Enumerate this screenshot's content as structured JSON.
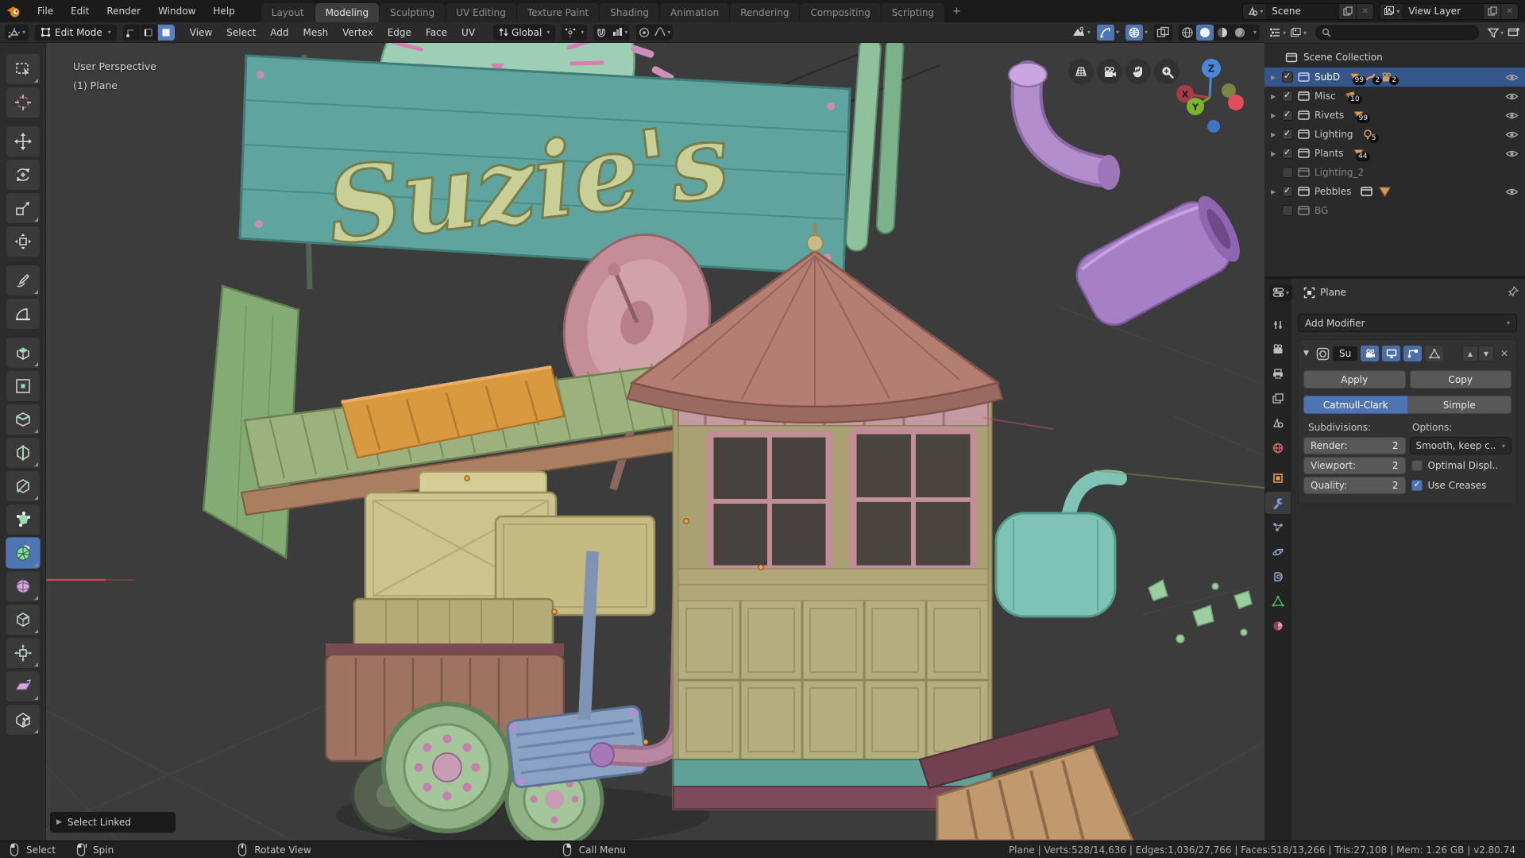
{
  "colors": {
    "accent_blue": "#4772b3",
    "selection_blue": "#35568b",
    "active_tool_blue": "#4f76b3",
    "badge_orange": "#d89a63",
    "viewport_bg": "#3c3c3c"
  },
  "topbar": {
    "menus": [
      {
        "label": "File"
      },
      {
        "label": "Edit"
      },
      {
        "label": "Render"
      },
      {
        "label": "Window"
      },
      {
        "label": "Help"
      }
    ],
    "workspaces": [
      {
        "label": "Layout"
      },
      {
        "label": "Modeling",
        "active": true
      },
      {
        "label": "Sculpting"
      },
      {
        "label": "UV Editing"
      },
      {
        "label": "Texture Paint"
      },
      {
        "label": "Shading"
      },
      {
        "label": "Animation"
      },
      {
        "label": "Rendering"
      },
      {
        "label": "Compositing"
      },
      {
        "label": "Scripting"
      }
    ],
    "add_workspace": "+",
    "scene": {
      "label": "Scene",
      "clear": "✕"
    },
    "view_layer": {
      "label": "View Layer",
      "clear": "✕"
    }
  },
  "viewport_header": {
    "mode": "Edit Mode",
    "menus": [
      {
        "label": "View"
      },
      {
        "label": "Select"
      },
      {
        "label": "Add"
      },
      {
        "label": "Mesh"
      },
      {
        "label": "Vertex"
      },
      {
        "label": "Edge"
      },
      {
        "label": "Face"
      },
      {
        "label": "UV"
      }
    ],
    "orientation": "Global"
  },
  "toolbar": {
    "active_tool": "spin",
    "tools": [
      {
        "id": "select-box",
        "sub": true
      },
      {
        "id": "cursor"
      },
      {
        "id": "move",
        "gap": true
      },
      {
        "id": "rotate"
      },
      {
        "id": "scale",
        "sub": true
      },
      {
        "id": "transform"
      },
      {
        "id": "annotate",
        "gap": true,
        "sub": true
      },
      {
        "id": "measure"
      },
      {
        "id": "extrude-region",
        "gap": true,
        "sub": true
      },
      {
        "id": "inset-faces"
      },
      {
        "id": "bevel",
        "sub": true
      },
      {
        "id": "loop-cut",
        "sub": true
      },
      {
        "id": "knife",
        "sub": true
      },
      {
        "id": "poly-build"
      },
      {
        "id": "spin",
        "sub": true
      },
      {
        "id": "smooth",
        "sub": true
      },
      {
        "id": "edge-slide",
        "sub": true
      },
      {
        "id": "shrink-fatten",
        "sub": true
      },
      {
        "id": "shear",
        "sub": true
      },
      {
        "id": "rip-region",
        "sub": true
      }
    ]
  },
  "viewport": {
    "overlay_line1": "User Perspective",
    "overlay_line2": "(1) Plane",
    "sign_text": "Suzie's",
    "operator_panel": "Select Linked",
    "gizmo": {
      "x": "X",
      "y": "Y",
      "z": "Z"
    }
  },
  "outliner": {
    "root": "Scene Collection",
    "rows": [
      {
        "name": "SubD",
        "checked": true,
        "selected": true,
        "arrow": true,
        "eye": true,
        "badges": [
          {
            "icon": "mesh",
            "count": "99"
          },
          {
            "icon": "curve",
            "count": "2"
          },
          {
            "icon": "camera",
            "count": "2"
          }
        ]
      },
      {
        "name": "Misc",
        "checked": true,
        "arrow": true,
        "eye": true,
        "badges": [
          {
            "icon": "mesh-multi",
            "count": "10"
          }
        ]
      },
      {
        "name": "Rivets",
        "checked": true,
        "arrow": true,
        "eye": true,
        "badges": [
          {
            "icon": "mesh",
            "count": "99"
          }
        ]
      },
      {
        "name": "Lighting",
        "checked": true,
        "arrow": true,
        "eye": true,
        "badges": [
          {
            "icon": "light",
            "count": "5"
          }
        ]
      },
      {
        "name": "Plants",
        "checked": true,
        "arrow": true,
        "eye": true,
        "badges": [
          {
            "icon": "mesh",
            "count": "44"
          }
        ]
      },
      {
        "name": "Lighting_2",
        "checked": false,
        "arrow": false,
        "eye": false,
        "badges": []
      },
      {
        "name": "Pebbles",
        "checked": true,
        "arrow": true,
        "eye": true,
        "badges": [
          {
            "icon": "collection"
          },
          {
            "icon": "mesh-big"
          }
        ]
      },
      {
        "name": "BG",
        "checked": false,
        "arrow": false,
        "eye": false,
        "badges": []
      }
    ]
  },
  "properties": {
    "tabs": [
      {
        "id": "tool"
      },
      {
        "id": "render"
      },
      {
        "id": "output"
      },
      {
        "id": "view-layer"
      },
      {
        "id": "scene"
      },
      {
        "id": "world"
      },
      {
        "id": "object",
        "gap": true
      },
      {
        "id": "modifiers",
        "active": true
      },
      {
        "id": "particles"
      },
      {
        "id": "physics"
      },
      {
        "id": "constraints"
      },
      {
        "id": "object-data"
      },
      {
        "id": "material"
      }
    ],
    "breadcrumb": "Plane",
    "add_modifier": "Add Modifier",
    "modifier": {
      "name": "Su",
      "apply": "Apply",
      "copy": "Copy",
      "types": [
        {
          "label": "Catmull-Clark",
          "active": true
        },
        {
          "label": "Simple",
          "active": false
        }
      ],
      "subdivisions_label": "Subdivisions:",
      "options_label": "Options:",
      "fields": [
        {
          "label": "Render:",
          "value": "2"
        },
        {
          "label": "Viewport:",
          "value": "2"
        },
        {
          "label": "Quality:",
          "value": "2"
        }
      ],
      "uv_smooth": "Smooth, keep c..",
      "options": [
        {
          "label": "Optimal Displ..",
          "checked": false
        },
        {
          "label": "Use Creases",
          "checked": true
        }
      ]
    }
  },
  "statusbar": {
    "hints": [
      {
        "mouse": "lmb",
        "label": "Select"
      },
      {
        "mouse": "lmb-drag",
        "label": "Spin"
      },
      {
        "mouse": "mmb",
        "label": "Rotate View"
      },
      {
        "mouse": "rmb",
        "label": "Call Menu"
      }
    ],
    "stats": "Plane | Verts:528/14,636 | Edges:1,036/27,766 | Faces:518/13,266 | Tris:27,108 | Mem: 1.26 GB | v2.80.74"
  }
}
